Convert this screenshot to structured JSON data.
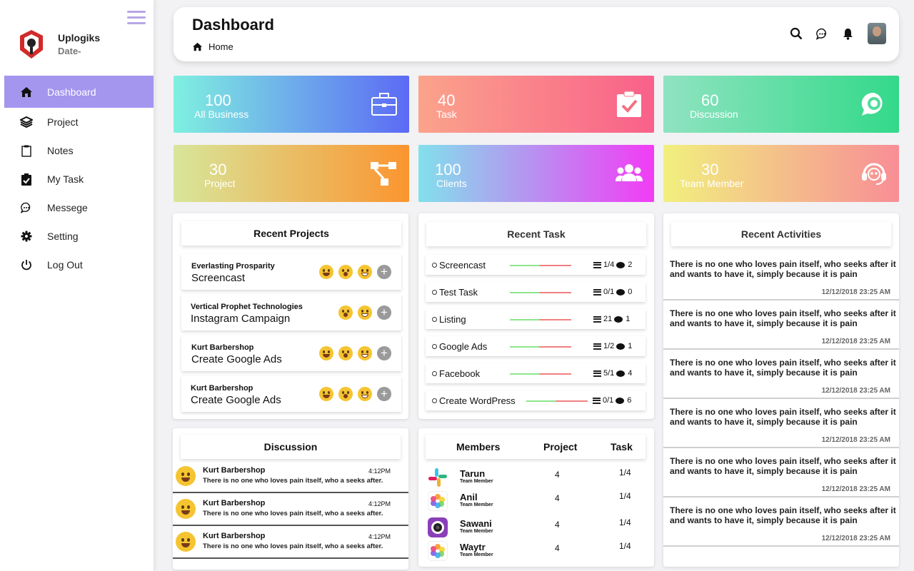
{
  "sidebar": {
    "brand_name": "Uplogiks",
    "brand_date": "Date-",
    "items": [
      {
        "label": "Dashboard",
        "icon": "home-icon"
      },
      {
        "label": "Project",
        "icon": "layers-icon"
      },
      {
        "label": "Notes",
        "icon": "clipboard-icon"
      },
      {
        "label": "My Task",
        "icon": "task-check-icon"
      },
      {
        "label": "Messege",
        "icon": "message-icon"
      },
      {
        "label": "Setting",
        "icon": "gear-icon"
      },
      {
        "label": "Log Out",
        "icon": "power-icon"
      }
    ]
  },
  "header": {
    "title": "Dashboard",
    "breadcrumb": "Home"
  },
  "stats": [
    {
      "value": "100",
      "label": "All Business",
      "icon": "briefcase-icon"
    },
    {
      "value": "40",
      "label": "Task",
      "icon": "clipboard-check-icon"
    },
    {
      "value": "60",
      "label": "Discussion",
      "icon": "chat-bubble-icon"
    },
    {
      "value": "30",
      "label": "Project",
      "icon": "sitemap-icon"
    },
    {
      "value": "100",
      "label": "Clients",
      "icon": "users-icon"
    },
    {
      "value": "30",
      "label": "Team Member",
      "icon": "headset-icon"
    }
  ],
  "recent_projects": {
    "title": "Recent Projects",
    "items": [
      {
        "company": "Everlasting Prosparity",
        "name": "Screencast"
      },
      {
        "company": "Vertical Prophet Technologies",
        "name": "Instagram Campaign"
      },
      {
        "company": "Kurt Barbershop",
        "name": "Create Google Ads"
      },
      {
        "company": "Kurt Barbershop",
        "name": "Create Google Ads"
      }
    ]
  },
  "recent_task": {
    "title": "Recent Task",
    "items": [
      {
        "name": "Screencast",
        "count": "1/4",
        "comments": "2"
      },
      {
        "name": "Test Task",
        "count": "0/1",
        "comments": "0"
      },
      {
        "name": "Listing",
        "count": "21",
        "comments": "1"
      },
      {
        "name": "Google Ads",
        "count": "1/2",
        "comments": "1"
      },
      {
        "name": "Facebook",
        "count": "5/1",
        "comments": "4"
      },
      {
        "name": "Create WordPress",
        "count": "0/1",
        "comments": "6"
      }
    ]
  },
  "recent_activities": {
    "title": "Recent Activities",
    "items": [
      {
        "text": "There is no one who loves pain itself, who seeks after it and wants to have it, simply because it is pain",
        "time": "12/12/2018 23:25 AM"
      },
      {
        "text": "There is no one who loves pain itself, who seeks after it and wants to have it, simply because it is pain",
        "time": "12/12/2018 23:25 AM"
      },
      {
        "text": "There is no one who loves pain itself, who seeks after it and wants to have it, simply because it is pain",
        "time": "12/12/2018 23:25 AM"
      },
      {
        "text": "There is no one who loves pain itself, who seeks after it and wants to have it, simply because it is pain",
        "time": "12/12/2018 23:25 AM"
      },
      {
        "text": "There is no one who loves pain itself, who seeks after it and wants to have it, simply because it is pain",
        "time": "12/12/2018 23:25 AM"
      },
      {
        "text": "There is no one who loves pain itself, who seeks after it and wants to have it, simply because it is pain",
        "time": "12/12/2018 23:25 AM"
      }
    ]
  },
  "discussion": {
    "title": "Discussion",
    "items": [
      {
        "name": "Kurt Barbershop",
        "time": "4:12PM",
        "message": "There is no one who loves pain itself, who a seeks after."
      },
      {
        "name": "Kurt Barbershop",
        "time": "4:12PM",
        "message": "There is no one who loves pain itself, who a seeks after."
      },
      {
        "name": "Kurt Barbershop",
        "time": "4:12PM",
        "message": "There is no one who loves pain itself, who a seeks after."
      }
    ]
  },
  "members": {
    "headers": {
      "members": "Members",
      "project": "Project",
      "task": "Task"
    },
    "items": [
      {
        "name": "Tarun",
        "role": "Team Member",
        "project": "4",
        "task": "1/4",
        "logo": "slack-logo-icon"
      },
      {
        "name": "Anil",
        "role": "Team Member",
        "project": "4",
        "task": "1/4",
        "logo": "photos-logo-icon"
      },
      {
        "name": "Sawani",
        "role": "Team Member",
        "project": "4",
        "task": "1/4",
        "logo": "camera-logo-icon"
      },
      {
        "name": "Waytr",
        "role": "Team Member",
        "project": "4",
        "task": "1/4",
        "logo": "photos-logo-icon"
      }
    ]
  },
  "colors": {
    "accent": "#a495ef",
    "menu_icon": "#b7a6e6"
  }
}
